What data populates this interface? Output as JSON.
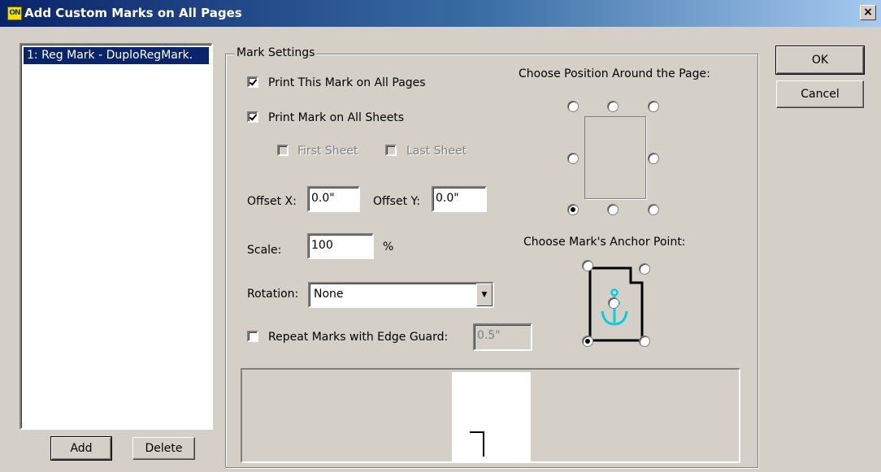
{
  "window": {
    "icon_text": "ON",
    "title": "Add Custom Marks on All Pages",
    "close_label": "×"
  },
  "marks_list": {
    "items": [
      {
        "label": "1: Reg Mark - DuploRegMark."
      }
    ]
  },
  "buttons": {
    "add": "Add",
    "delete": "Delete",
    "ok": "OK",
    "cancel": "Cancel"
  },
  "mark_settings": {
    "legend": "Mark Settings",
    "print_all_pages": {
      "label": "Print This Mark on All Pages",
      "checked": true
    },
    "print_all_sheets": {
      "label": "Print Mark on All Sheets",
      "checked": true
    },
    "first_sheet": {
      "label": "First Sheet",
      "checked": false,
      "enabled": false
    },
    "last_sheet": {
      "label": "Last Sheet",
      "checked": false,
      "enabled": false
    },
    "offset_x": {
      "label": "Offset X:",
      "value": "0.0\""
    },
    "offset_y": {
      "label": "Offset Y:",
      "value": "0.0\""
    },
    "scale": {
      "label": "Scale:",
      "value": "100",
      "unit": "%"
    },
    "rotation": {
      "label": "Rotation:",
      "value": "None"
    },
    "repeat_edge_guard": {
      "label": "Repeat Marks with Edge Guard:",
      "checked": false,
      "value": "0.5\""
    }
  },
  "position": {
    "label": "Choose Position Around the Page:",
    "selected": "bottom-left"
  },
  "anchor": {
    "label": "Choose Mark's Anchor Point:",
    "selected": "bottom-left",
    "icon_color": "#00d0e0"
  }
}
